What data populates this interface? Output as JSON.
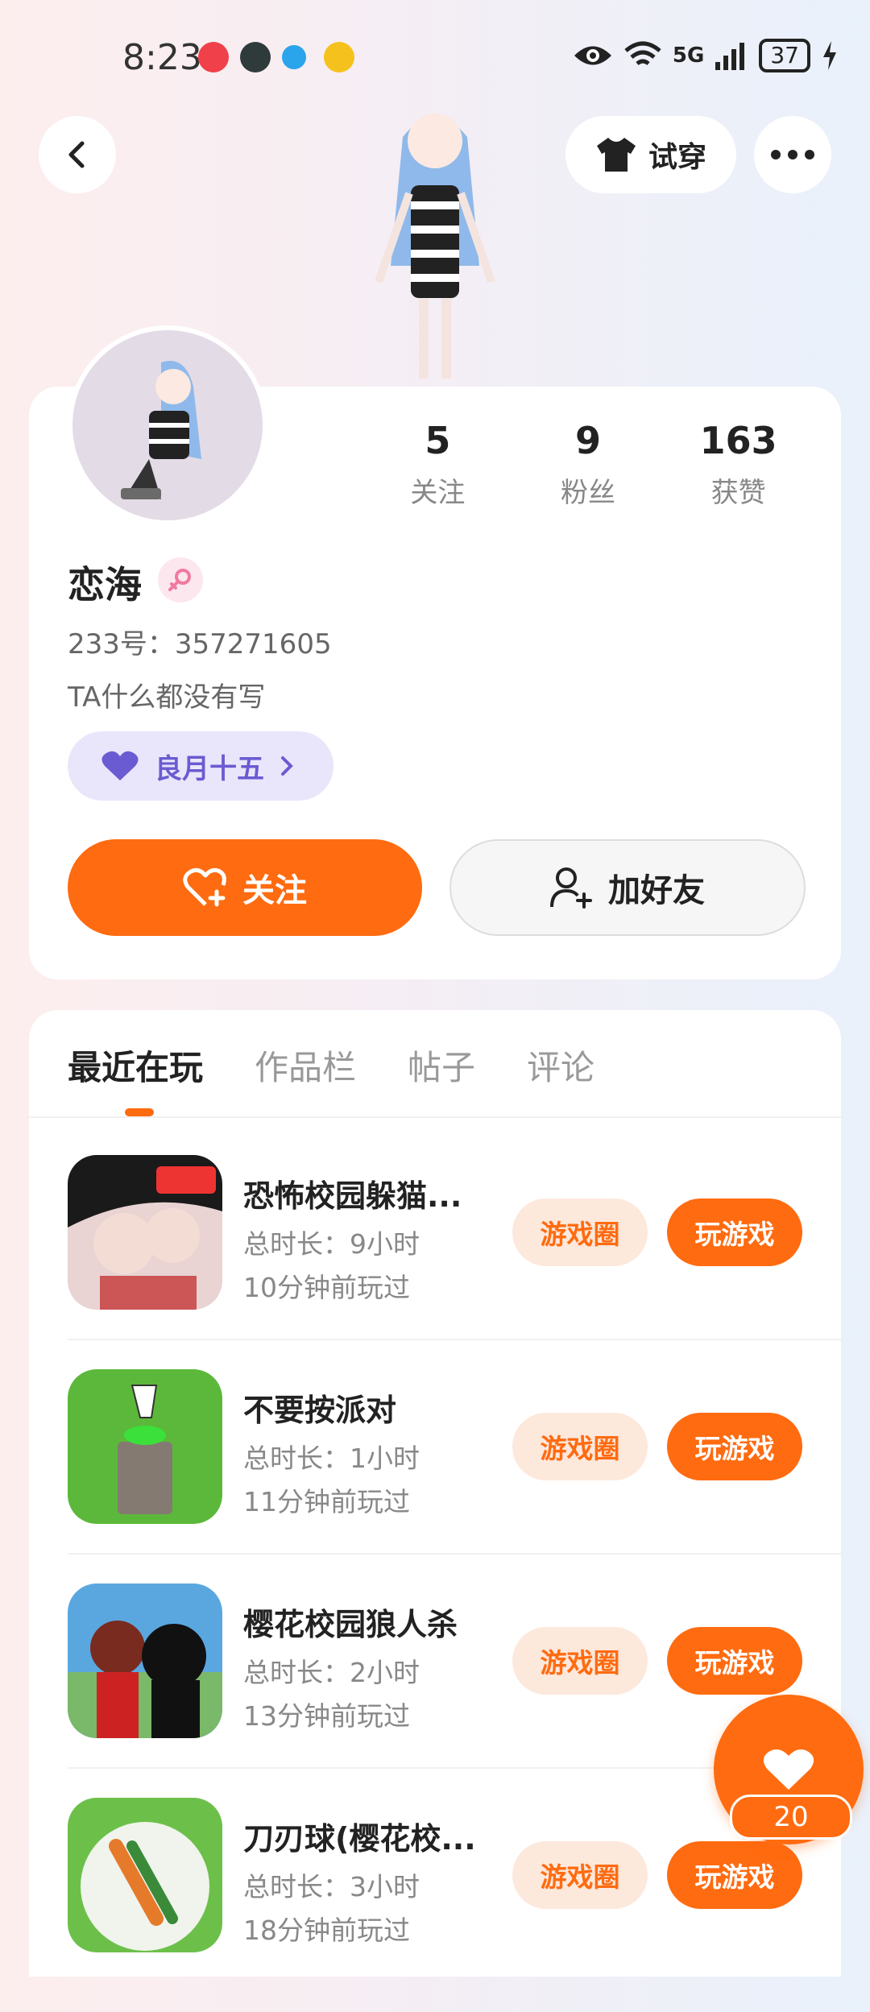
{
  "status_bar": {
    "time": "8:23",
    "network": "5G",
    "battery": "37",
    "icons": [
      "eye-icon",
      "wifi-icon",
      "signal-icon",
      "charging-icon"
    ]
  },
  "header": {
    "back_icon": "chevron-left-icon",
    "try_on_label": "试穿",
    "more_icon": "more-icon"
  },
  "profile": {
    "name": "恋海",
    "gender_icon": "female-icon",
    "id_text": "233号：357271605",
    "bio": "TA什么都没有写",
    "tag_label": "良月十五",
    "stats": [
      {
        "value": "5",
        "label": "关注"
      },
      {
        "value": "9",
        "label": "粉丝"
      },
      {
        "value": "163",
        "label": "获赞"
      }
    ],
    "follow_label": "关注",
    "add_friend_label": "加好友"
  },
  "tabs": [
    {
      "label": "最近在玩",
      "active": true
    },
    {
      "label": "作品栏",
      "active": false
    },
    {
      "label": "帖子",
      "active": false
    },
    {
      "label": "评论",
      "active": false
    }
  ],
  "games": [
    {
      "title": "恐怖校园躲猫...",
      "duration": "总时长：9小时",
      "last_played": "10分钟前玩过",
      "circle_label": "游戏圈",
      "play_label": "玩游戏"
    },
    {
      "title": "不要按派对",
      "duration": "总时长：1小时",
      "last_played": "11分钟前玩过",
      "circle_label": "游戏圈",
      "play_label": "玩游戏"
    },
    {
      "title": "樱花校园狼人杀",
      "duration": "总时长：2小时",
      "last_played": "13分钟前玩过",
      "circle_label": "游戏圈",
      "play_label": "玩游戏"
    },
    {
      "title": "刀刃球(樱花校...",
      "duration": "总时长：3小时",
      "last_played": "18分钟前玩过",
      "circle_label": "游戏圈",
      "play_label": "玩游戏"
    }
  ],
  "fab": {
    "icon": "heart-icon",
    "count": "20"
  },
  "colors": {
    "accent": "#ff6b10",
    "accent_light": "#fde8dc",
    "tag_bg": "#e9e6fb",
    "tag_text": "#6b5bd2"
  }
}
